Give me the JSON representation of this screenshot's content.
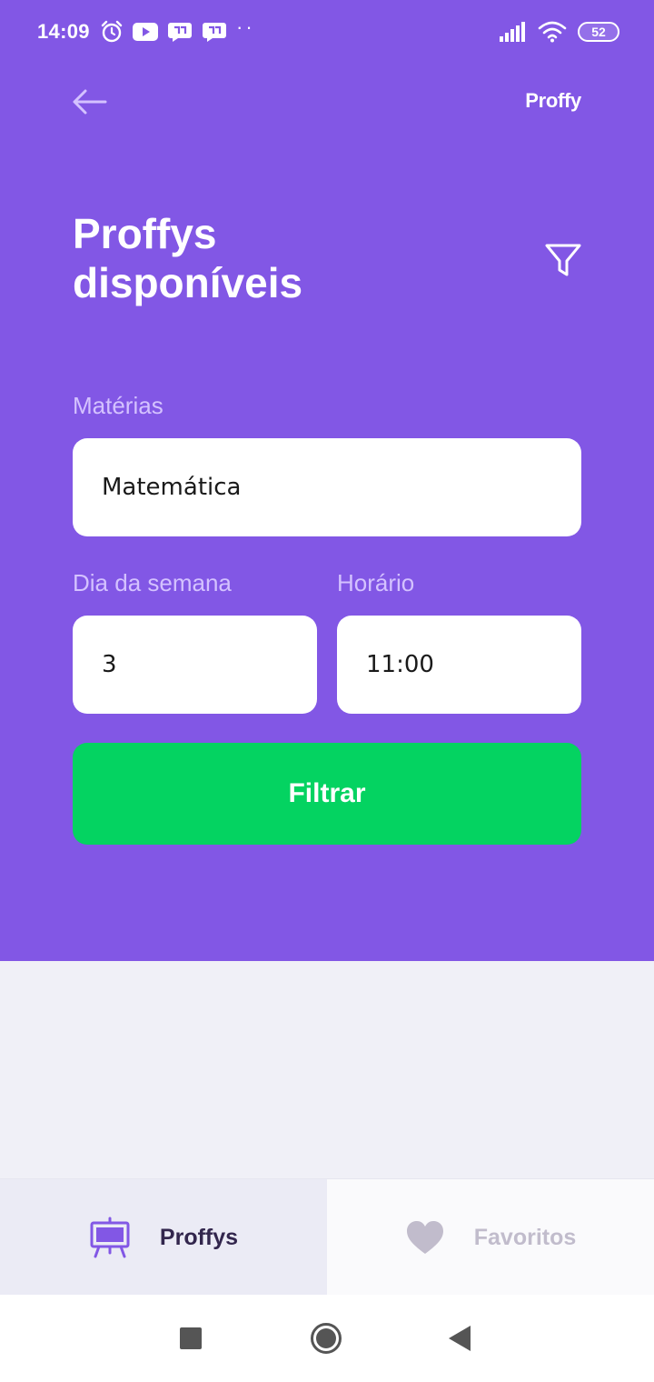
{
  "status_bar": {
    "time": "14:09",
    "battery": "52",
    "left_icons": [
      "alarm-icon",
      "youtube-icon",
      "chat-icon",
      "chat-icon"
    ],
    "right_icons": [
      "signal-icon",
      "wifi-icon",
      "battery-icon"
    ]
  },
  "header": {
    "brand": "Proffy",
    "back_icon": "arrow-left-icon",
    "title": "Proffys disponíveis",
    "filter_icon": "filter-icon"
  },
  "filters": {
    "subject_label": "Matérias",
    "subject_value": "Matemática",
    "weekday_label": "Dia da semana",
    "weekday_value": "3",
    "time_label": "Horário",
    "time_value": "11:00",
    "submit_label": "Filtrar"
  },
  "tabs": [
    {
      "label": "Proffys",
      "icon": "easel-icon",
      "active": true
    },
    {
      "label": "Favoritos",
      "icon": "heart-icon",
      "active": false
    }
  ],
  "colors": {
    "primary": "#8257E5",
    "secondary": "#04D361",
    "background": "#F0F0F7",
    "label_light": "#D4C2FF"
  }
}
